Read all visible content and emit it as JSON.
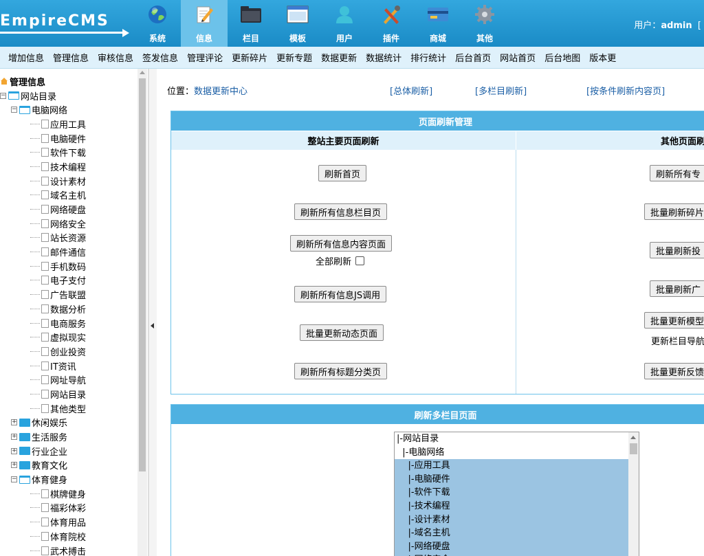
{
  "app": {
    "logo_text": "EmpireCMS"
  },
  "nav": [
    {
      "label": "系统",
      "icon": "globe-icon"
    },
    {
      "label": "信息",
      "icon": "pencil-notepad-icon",
      "active": true
    },
    {
      "label": "栏目",
      "icon": "folder-icon"
    },
    {
      "label": "模板",
      "icon": "window-template-icon"
    },
    {
      "label": "用户",
      "icon": "user-icon"
    },
    {
      "label": "插件",
      "icon": "tools-icon"
    },
    {
      "label": "商城",
      "icon": "credit-card-icon"
    },
    {
      "label": "其他",
      "icon": "gear-icon"
    }
  ],
  "user": {
    "prefix": "用户：",
    "name": "admin",
    "suffix": "["
  },
  "submenu": [
    "增加信息",
    "管理信息",
    "审核信息",
    "签发信息",
    "管理评论",
    "更新碎片",
    "更新专题",
    "数据更新",
    "数据统计",
    "排行统计",
    "后台首页",
    "网站首页",
    "后台地图",
    "版本更"
  ],
  "sidebar": {
    "title": "管理信息",
    "root": "网站目录",
    "group1": "电脑网络",
    "group1_items": [
      "应用工具",
      "电脑硬件",
      "软件下载",
      "技术编程",
      "设计素材",
      "域名主机",
      "网络硬盘",
      "网络安全",
      "站长资源",
      "邮件通信",
      "手机数码",
      "电子支付",
      "广告联盟",
      "数据分析",
      "电商服务",
      "虚拟现实",
      "创业投资",
      "IT资讯",
      "网址导航",
      "网站目录",
      "其他类型"
    ],
    "collapsed_groups": [
      "休闲娱乐",
      "生活服务",
      "行业企业",
      "教育文化"
    ],
    "group2": "体育健身",
    "group2_items": [
      "棋牌健身",
      "福彩体彩",
      "体育用品",
      "体育院校",
      "武术搏击"
    ]
  },
  "main": {
    "location_label": "位置：",
    "location_link": "数据更新中心",
    "link_all": "[总体刷新]",
    "link_multi": "[多栏目刷新]",
    "link_cond": "[按条件刷新内容页]",
    "panel1_title": "页面刷新管理",
    "left_head": "整站主要页面刷新",
    "right_head": "其他页面刷",
    "left_buttons": [
      "刷新首页",
      "刷新所有信息栏目页",
      "刷新所有信息内容页面",
      "刷新所有信息JS调用",
      "批量更新动态页面",
      "刷新所有标题分类页"
    ],
    "full_refresh_label": "全部刷新",
    "right_buttons": [
      "刷新所有专",
      "批量刷新碎片",
      "批量刷新投",
      "批量刷新广",
      "批量更新模型",
      "批量更新反馈"
    ],
    "right_text": "更新栏目导航",
    "panel2_title": "刷新多栏目页面",
    "list_items": [
      {
        "text": "|-网站目录",
        "selected": false
      },
      {
        "text": "  |-电脑网络",
        "selected": false
      },
      {
        "text": "    |-应用工具",
        "selected": true
      },
      {
        "text": "    |-电脑硬件",
        "selected": true
      },
      {
        "text": "    |-软件下载",
        "selected": true
      },
      {
        "text": "    |-技术编程",
        "selected": true
      },
      {
        "text": "    |-设计素材",
        "selected": true
      },
      {
        "text": "    |-域名主机",
        "selected": true
      },
      {
        "text": "    |-网络硬盘",
        "selected": true
      },
      {
        "text": "    |-网络安全",
        "selected": true
      }
    ]
  }
}
